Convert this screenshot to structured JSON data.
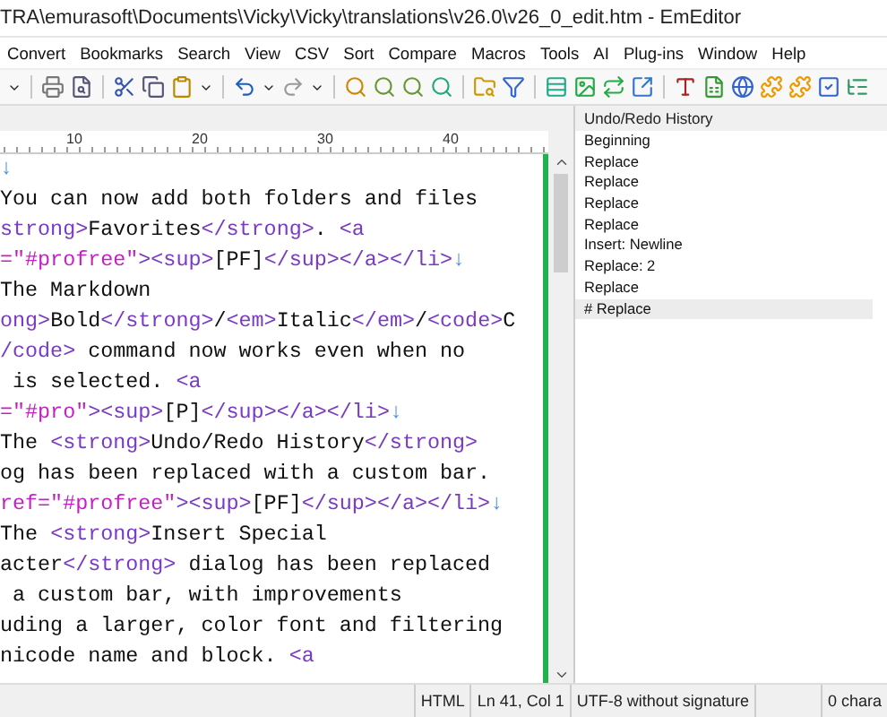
{
  "window": {
    "title": "TRA\\emurasoft\\Documents\\Vicky\\Vicky\\translations\\v26.0\\v26_0_edit.htm - EmEditor"
  },
  "menu": [
    "Convert",
    "Bookmarks",
    "Search",
    "View",
    "CSV",
    "Sort",
    "Compare",
    "Macros",
    "Tools",
    "AI",
    "Plug-ins",
    "Window",
    "Help"
  ],
  "ruler": [
    "10",
    "20",
    "30",
    "40"
  ],
  "editor": {
    "lines": [
      [
        {
          "kind": "mark",
          "text": "↓"
        }
      ],
      [
        {
          "kind": "text",
          "text": "You can now add both folders and files"
        }
      ],
      [
        {
          "kind": "tag",
          "text": "strong>"
        },
        {
          "kind": "text",
          "text": "Favorites"
        },
        {
          "kind": "tag",
          "text": "</strong>"
        },
        {
          "kind": "text",
          "text": ". "
        },
        {
          "kind": "tag",
          "text": "<a"
        }
      ],
      [
        {
          "kind": "attr",
          "text": "=\"#profree\""
        },
        {
          "kind": "tag",
          "text": "><sup>"
        },
        {
          "kind": "text",
          "text": "[PF]"
        },
        {
          "kind": "tag",
          "text": "</sup></a></li>"
        },
        {
          "kind": "mark",
          "text": "↓"
        }
      ],
      [
        {
          "kind": "text",
          "text": "The Markdown"
        }
      ],
      [
        {
          "kind": "tag",
          "text": "ong>"
        },
        {
          "kind": "text",
          "text": "Bold"
        },
        {
          "kind": "tag",
          "text": "</strong>"
        },
        {
          "kind": "text",
          "text": "/"
        },
        {
          "kind": "tag",
          "text": "<em>"
        },
        {
          "kind": "text",
          "text": "Italic"
        },
        {
          "kind": "tag",
          "text": "</em>"
        },
        {
          "kind": "text",
          "text": "/"
        },
        {
          "kind": "tag",
          "text": "<code>"
        },
        {
          "kind": "text",
          "text": "C"
        }
      ],
      [
        {
          "kind": "tag",
          "text": "/code>"
        },
        {
          "kind": "text",
          "text": " command now works even when no"
        }
      ],
      [
        {
          "kind": "text",
          "text": " is selected. "
        },
        {
          "kind": "tag",
          "text": "<a"
        }
      ],
      [
        {
          "kind": "attr",
          "text": "=\"#pro\""
        },
        {
          "kind": "tag",
          "text": "><sup>"
        },
        {
          "kind": "text",
          "text": "[P]"
        },
        {
          "kind": "tag",
          "text": "</sup></a></li>"
        },
        {
          "kind": "mark",
          "text": "↓"
        }
      ],
      [
        {
          "kind": "text",
          "text": "The "
        },
        {
          "kind": "tag",
          "text": "<strong>"
        },
        {
          "kind": "text",
          "text": "Undo/Redo History"
        },
        {
          "kind": "tag",
          "text": "</strong>"
        }
      ],
      [
        {
          "kind": "text",
          "text": "og has been replaced with a custom bar."
        }
      ],
      [
        {
          "kind": "attr",
          "text": "ref=\"#profree\""
        },
        {
          "kind": "tag",
          "text": "><sup>"
        },
        {
          "kind": "text",
          "text": "[PF]"
        },
        {
          "kind": "tag",
          "text": "</sup></a></li>"
        },
        {
          "kind": "mark",
          "text": "↓"
        }
      ],
      [
        {
          "kind": "text",
          "text": "The "
        },
        {
          "kind": "tag",
          "text": "<strong>"
        },
        {
          "kind": "text",
          "text": "Insert Special"
        }
      ],
      [
        {
          "kind": "text",
          "text": "acter"
        },
        {
          "kind": "tag",
          "text": "</strong>"
        },
        {
          "kind": "text",
          "text": " dialog has been replaced"
        }
      ],
      [
        {
          "kind": "text",
          "text": " a custom bar, with improvements"
        }
      ],
      [
        {
          "kind": "text",
          "text": "uding a larger, color font and filtering"
        }
      ],
      [
        {
          "kind": "text",
          "text": "nicode name and block. "
        },
        {
          "kind": "tag",
          "text": "<a"
        }
      ]
    ]
  },
  "history": {
    "title": "Undo/Redo History",
    "items": [
      {
        "label": "Beginning",
        "selected": false
      },
      {
        "label": "Replace",
        "selected": false
      },
      {
        "label": "Replace",
        "selected": false
      },
      {
        "label": "Replace",
        "selected": false
      },
      {
        "label": "Replace",
        "selected": false
      },
      {
        "label": "Insert: Newline",
        "selected": false
      },
      {
        "label": "Replace: 2",
        "selected": false
      },
      {
        "label": "Replace",
        "selected": false
      },
      {
        "label": "# Replace",
        "selected": true
      }
    ]
  },
  "status_bar": [
    "HTML",
    "Ln 41, Col 1",
    "UTF-8 without signature",
    "0 chara"
  ]
}
